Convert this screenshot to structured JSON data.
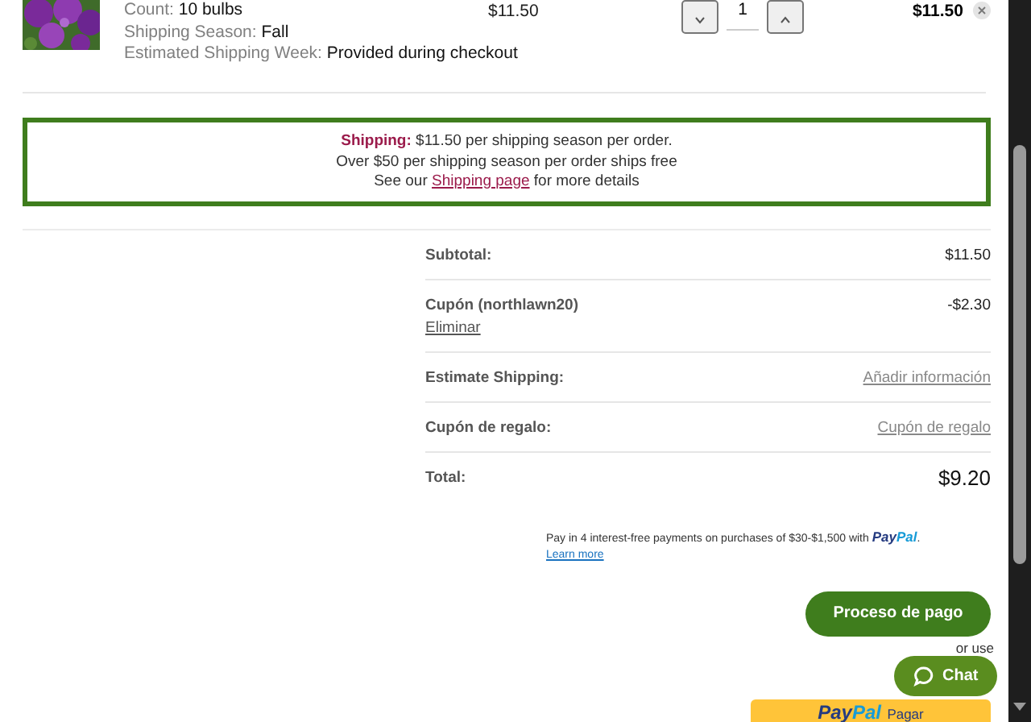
{
  "cart_item": {
    "details": [
      {
        "label": "Count:",
        "value": "10 bulbs"
      },
      {
        "label": "Shipping Season:",
        "value": "Fall"
      },
      {
        "label": "Estimated Shipping Week:",
        "value": "Provided during checkout"
      }
    ],
    "price": "$11.50",
    "quantity": "1",
    "total": "$11.50"
  },
  "shipping_notice": {
    "lines": [
      {
        "text": "**Shipping:** $11.50  per shipping season per order."
      },
      {
        "text": "Over $50 per shipping season per order ships free"
      },
      {
        "text": "See our",
        "link": "Shipping page",
        "after": "for more details"
      }
    ]
  },
  "summary": {
    "rows": [
      {
        "kind": "plain",
        "label": "Subtotal:",
        "value": "$11.50"
      },
      {
        "kind": "coupon",
        "label": "Cupón (northlawn20)",
        "value": "-$2.30",
        "link": "Eliminar"
      },
      {
        "kind": "link",
        "label": "Estimate Shipping:",
        "link": "Añadir información"
      },
      {
        "kind": "link",
        "label": "Cupón de regalo:",
        "link": "Cupón de regalo"
      },
      {
        "kind": "total",
        "label": "Total:",
        "value": "$9.20"
      }
    ]
  },
  "paypal_message": {
    "text": "Pay in 4 interest-free payments on purchases of $30-$1,500 with",
    "brand": "PayPal",
    "after": ".",
    "link": "Learn more"
  },
  "checkout_button": "Proceso de pago",
  "alt_text": "or use",
  "paypal_button": {
    "brand_a": "Pay",
    "brand_b": "Pal",
    "label": "Pagar"
  },
  "chat_button": "Chat"
}
